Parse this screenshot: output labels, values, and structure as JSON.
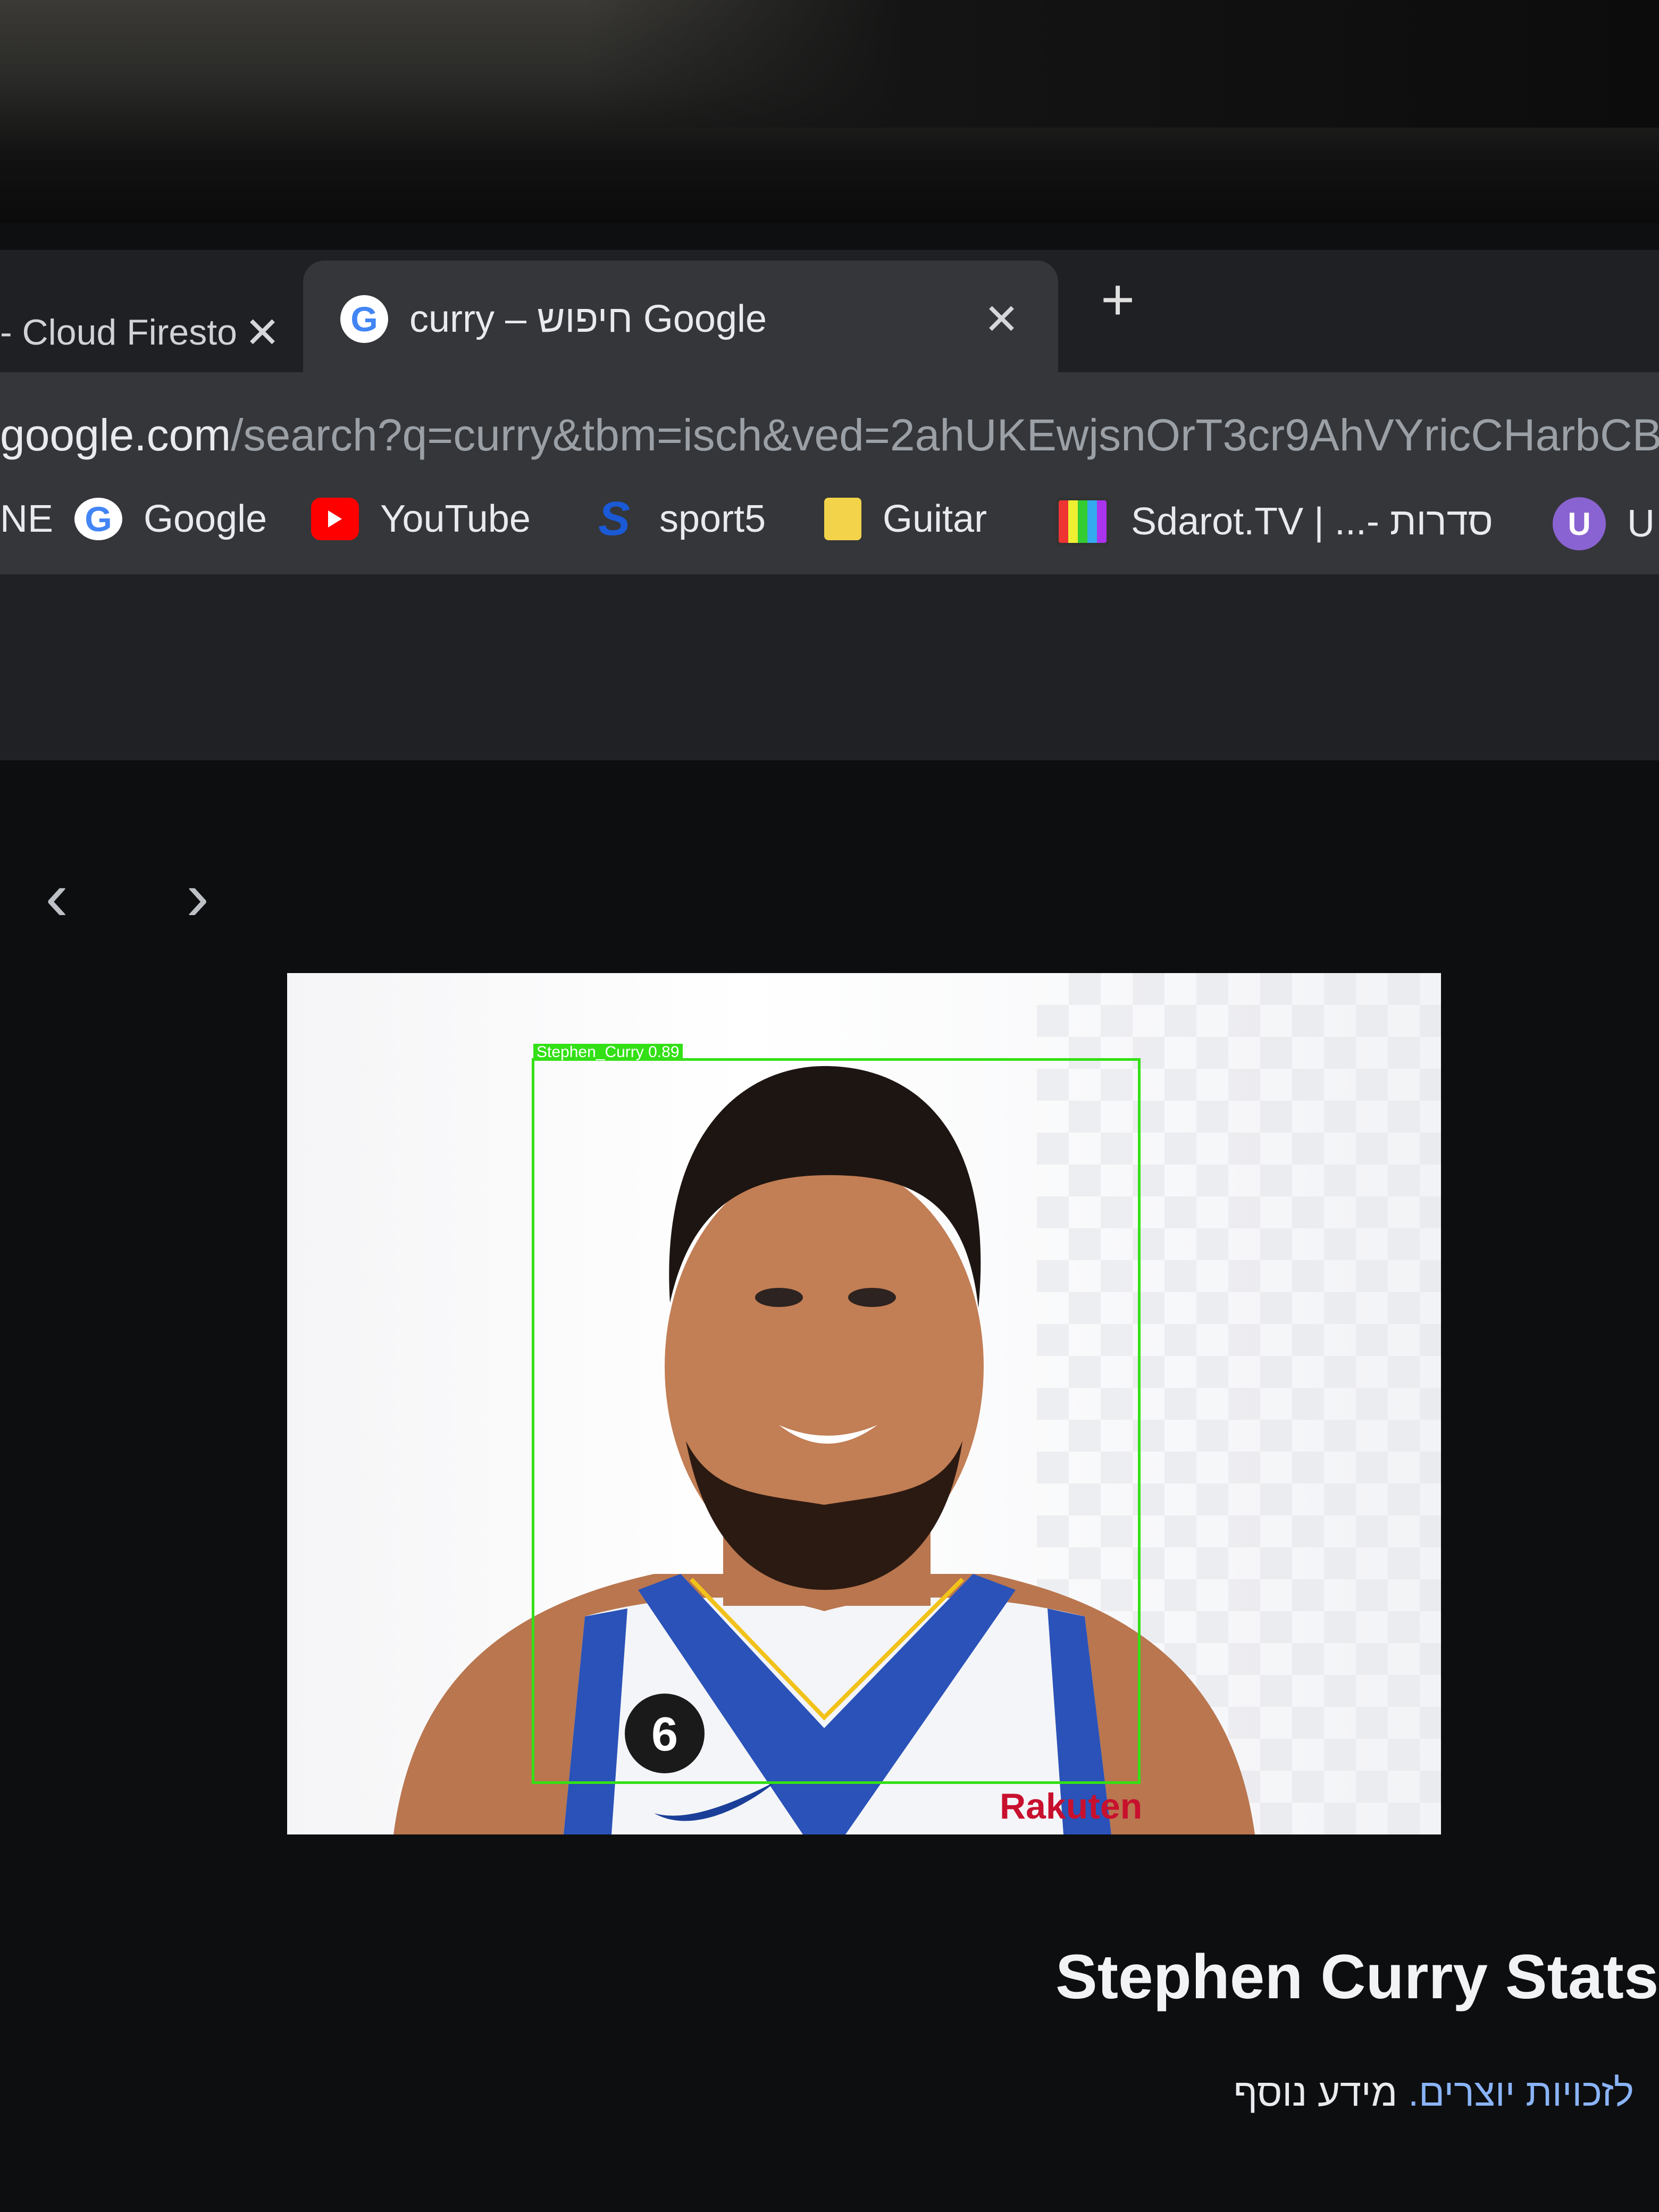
{
  "browser": {
    "tabs": [
      {
        "title": "- Cloud Firesto",
        "active": false
      },
      {
        "title": "curry – חיפוש Google",
        "active": true
      }
    ],
    "new_tab_label": "+",
    "close_glyph": "✕",
    "url": {
      "host": "google.com",
      "path": "/search?q=curry&tbm=isch&ved=2ahUKEwjsnOrT3cr9AhVYricCHarbCBcQ"
    },
    "bookmarks": [
      {
        "label": "NE",
        "icon": "none"
      },
      {
        "label": "Google",
        "icon": "google-icon"
      },
      {
        "label": "YouTube",
        "icon": "youtube-icon"
      },
      {
        "label": "sport5",
        "icon": "sport5-icon"
      },
      {
        "label": "Guitar",
        "icon": "folder-icon"
      },
      {
        "label": "Sdarot.TV | ...- סדרות",
        "icon": "tv-icon"
      },
      {
        "label": "U",
        "icon": "u-icon"
      }
    ]
  },
  "viewer": {
    "prev_arrow": "‹",
    "next_arrow": "›",
    "image": {
      "subject": "Stephen Curry portrait",
      "detection_label": "Stephen_Curry 0.89",
      "jersey_number": "6",
      "jersey_sponsor": "Rakuten"
    },
    "caption": "Stephen Curry Stats, N",
    "rights_text": {
      "link": "לזכויות יוצרים.",
      "more": "מידע נוסף"
    }
  }
}
